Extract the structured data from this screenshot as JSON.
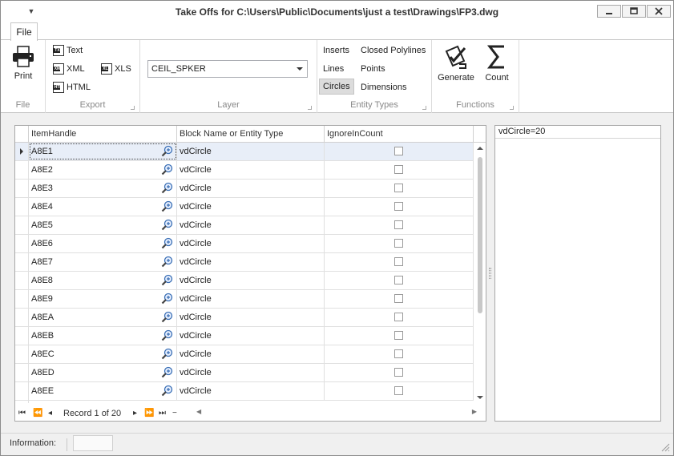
{
  "window": {
    "title": "Take Offs for C:\\Users\\Public\\Documents\\just a test\\Drawings\\FP3.dwg"
  },
  "ribbon": {
    "tab": "File",
    "groups": {
      "file": {
        "caption": "File",
        "print_label": "Print"
      },
      "export": {
        "caption": "Export",
        "text_label": "Text",
        "xml_label": "XML",
        "xls_label": "XLS",
        "html_label": "HTML"
      },
      "layer": {
        "caption": "Layer",
        "selected": "CEIL_SPKER"
      },
      "entity_types": {
        "caption": "Entity Types",
        "inserts": "Inserts",
        "closed_polylines": "Closed Polylines",
        "lines": "Lines",
        "points": "Points",
        "circles": "Circles",
        "dimensions": "Dimensions",
        "selected": "Circles"
      },
      "functions": {
        "caption": "Functions",
        "generate_label": "Generate",
        "count_label": "Count"
      }
    }
  },
  "grid": {
    "columns": [
      "ItemHandle",
      "Block Name or Entity Type",
      "IgnoreInCount"
    ],
    "rows": [
      {
        "handle": "A8E1",
        "type": "vdCircle"
      },
      {
        "handle": "A8E2",
        "type": "vdCircle"
      },
      {
        "handle": "A8E3",
        "type": "vdCircle"
      },
      {
        "handle": "A8E4",
        "type": "vdCircle"
      },
      {
        "handle": "A8E5",
        "type": "vdCircle"
      },
      {
        "handle": "A8E6",
        "type": "vdCircle"
      },
      {
        "handle": "A8E7",
        "type": "vdCircle"
      },
      {
        "handle": "A8E8",
        "type": "vdCircle"
      },
      {
        "handle": "A8E9",
        "type": "vdCircle"
      },
      {
        "handle": "A8EA",
        "type": "vdCircle"
      },
      {
        "handle": "A8EB",
        "type": "vdCircle"
      },
      {
        "handle": "A8EC",
        "type": "vdCircle"
      },
      {
        "handle": "A8ED",
        "type": "vdCircle"
      },
      {
        "handle": "A8EE",
        "type": "vdCircle"
      }
    ],
    "navigator": {
      "record_text": "Record 1 of 20"
    }
  },
  "summary": {
    "text": "vdCircle=20"
  },
  "status": {
    "label": "Information:"
  }
}
